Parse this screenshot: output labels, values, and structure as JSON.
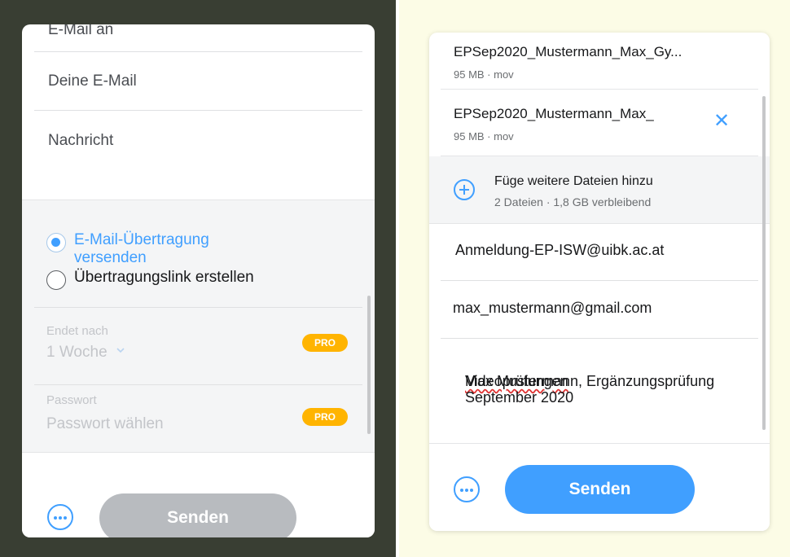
{
  "colors": {
    "accent": "#409fff",
    "pro_badge": "#ffb400",
    "disabled_button": "#b8bbbf",
    "left_background": "#393e33",
    "right_background": "#fcfce6"
  },
  "left": {
    "email_to_placeholder": "E-Mail an",
    "your_email_placeholder": "Deine E-Mail",
    "message_placeholder": "Nachricht",
    "transfer_options": [
      {
        "label": "E-Mail-Übertragung versenden",
        "selected": true
      },
      {
        "label": "Übertragungslink erstellen",
        "selected": false
      }
    ],
    "expires": {
      "label": "Endet nach",
      "value": "1 Woche",
      "badge": "PRO"
    },
    "password": {
      "label": "Passwort",
      "placeholder": "Passwort wählen",
      "badge": "PRO"
    },
    "send_label": "Senden",
    "more_icon": "ellipsis-circle-icon"
  },
  "right": {
    "files": [
      {
        "name": "EPSep2020_Mustermann_Max_Gy...",
        "meta": "95 MB · mov"
      },
      {
        "name": "EPSep2020_Mustermann_Max_",
        "meta": "95 MB · mov"
      }
    ],
    "add_files": {
      "title": "Füge weitere Dateien hinzu",
      "subtitle": "2 Dateien · 1,8 GB verbleibend"
    },
    "to_value": "Anmeldung-EP-ISW@uibk.ac.at",
    "from_value": "max_mustermann@gmail.com",
    "message_part1": "Videoprüfungen",
    "message_part2": " Max Mustermann, Ergänzungsprüfung September 2020",
    "send_label": "Senden",
    "more_icon": "ellipsis-circle-icon",
    "remove_icon": "close-icon"
  }
}
